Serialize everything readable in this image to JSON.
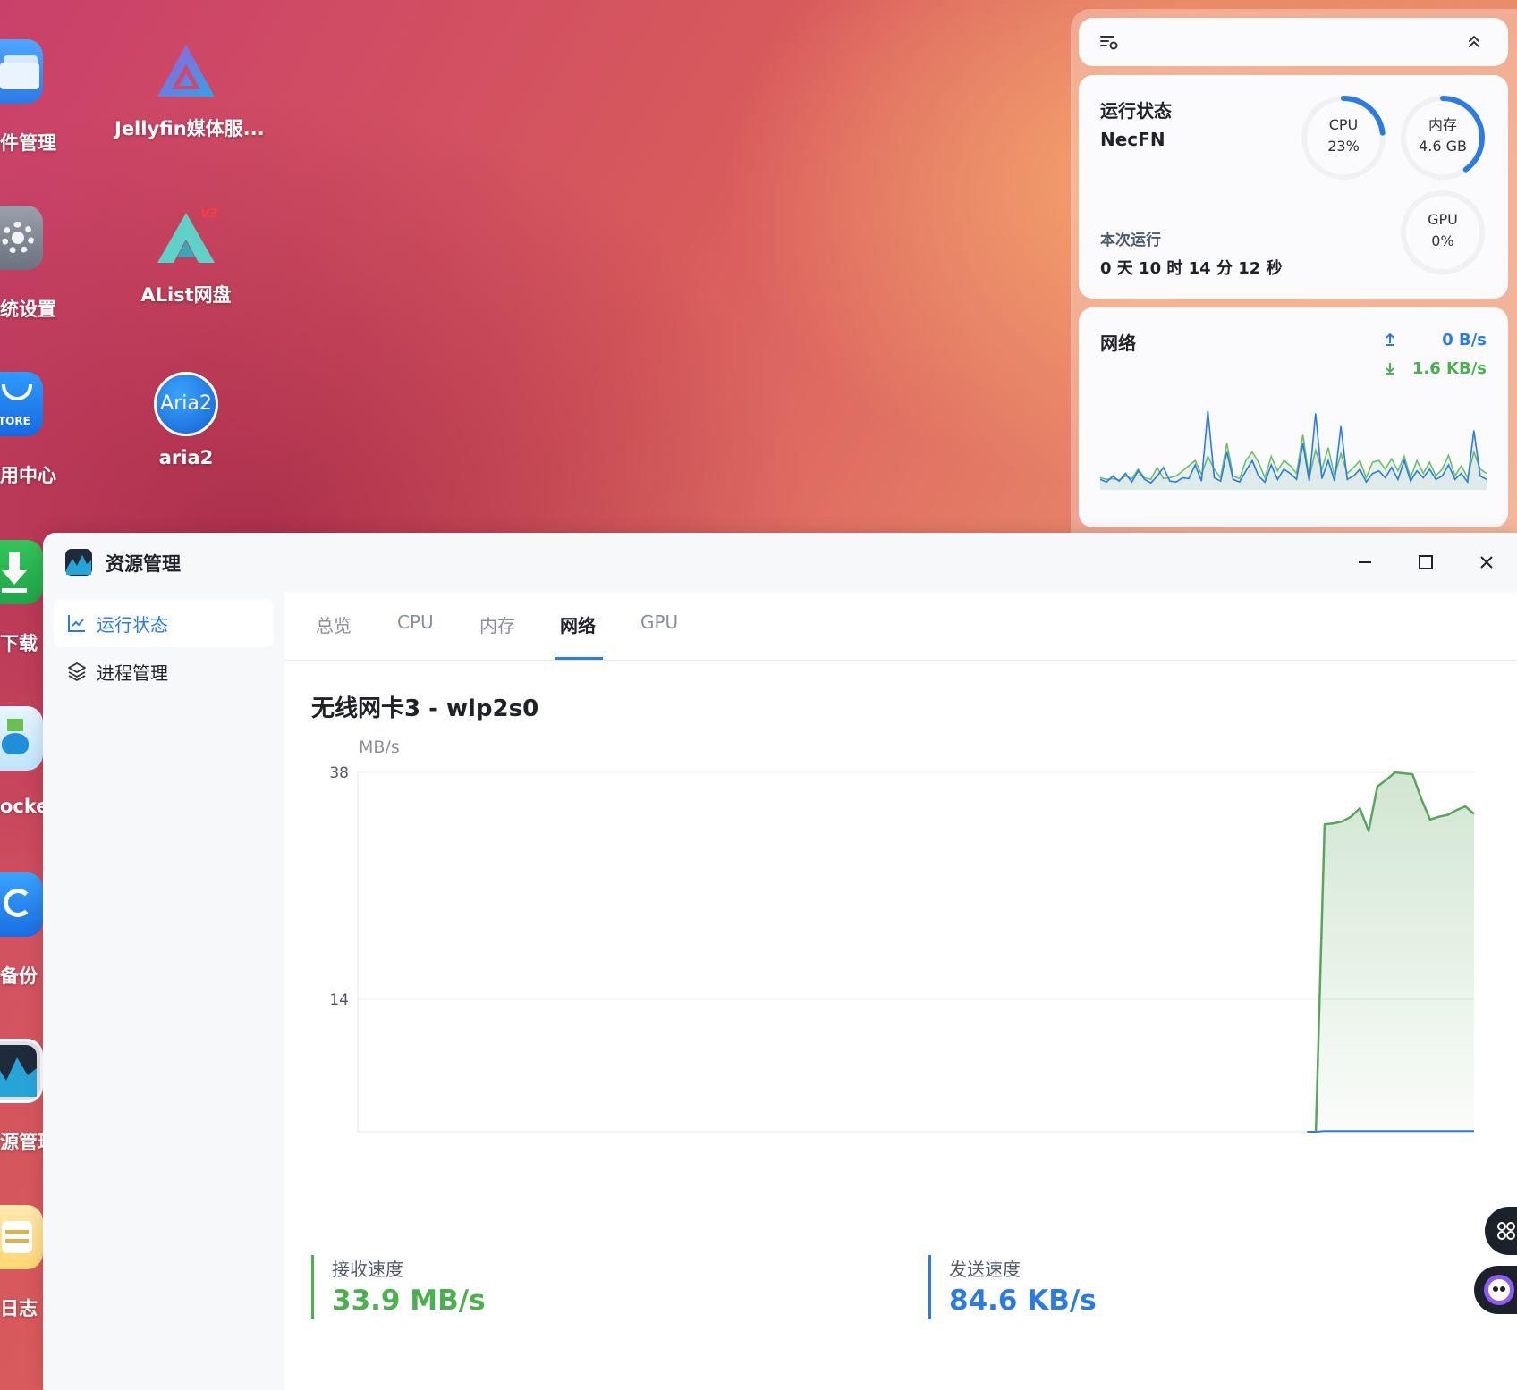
{
  "desktop": {
    "apps_col1": [
      {
        "label": "件管理"
      },
      {
        "label": "统设置"
      },
      {
        "label": "用中心",
        "badge": "TORE"
      }
    ],
    "apps_col2": [
      {
        "label": "Jellyfin媒体服..."
      },
      {
        "label": "AList网盘",
        "badge": "V3"
      },
      {
        "label": "aria2",
        "icon_text": "Aria2"
      }
    ],
    "dock": [
      {
        "label": "下载"
      },
      {
        "label": "ocker"
      },
      {
        "label": "备份"
      },
      {
        "label": "源管理"
      },
      {
        "label": "日志"
      }
    ]
  },
  "widgets": {
    "status": {
      "title": "运行状态",
      "host": "NecFN",
      "uptime_label": "本次运行",
      "uptime_value": "0 天 10 时 14 分 12 秒",
      "cpu": {
        "label": "CPU",
        "value": "23%",
        "fraction": 0.23
      },
      "memory": {
        "label": "内存",
        "value": "4.6 GB",
        "fraction": 0.4
      },
      "gpu": {
        "label": "GPU",
        "value": "0%",
        "fraction": 0
      }
    },
    "network": {
      "title": "网络",
      "upload": "0 B/s",
      "download": "1.6 KB/s"
    }
  },
  "window": {
    "title": "资源管理",
    "sidebar": [
      {
        "label": "运行状态",
        "active": true
      },
      {
        "label": "进程管理",
        "active": false
      }
    ],
    "tabs": [
      {
        "label": "总览"
      },
      {
        "label": "CPU"
      },
      {
        "label": "内存"
      },
      {
        "label": "网络",
        "active": true
      },
      {
        "label": "GPU"
      }
    ],
    "adapter_title": "无线网卡3 - wlp2s0",
    "receive": {
      "label": "接收速度",
      "value": "33.9 MB/s",
      "color": "#4caf50"
    },
    "send": {
      "label": "发送速度",
      "value": "84.6 KB/s",
      "color": "#2b7be5"
    }
  },
  "chart_data": {
    "type": "area",
    "ylabel": "MB/s",
    "yticks": [
      14,
      38
    ],
    "ylim": [
      0,
      38
    ],
    "grid": true,
    "series": [
      {
        "color": "#5aa55c",
        "values": [
          0,
          0,
          0,
          0,
          0,
          0,
          0,
          0,
          0,
          0,
          0,
          0,
          0,
          0,
          0,
          0,
          0,
          0,
          0,
          0,
          0,
          0,
          0,
          0,
          0,
          0,
          0,
          0,
          0,
          0,
          0,
          0,
          0,
          0,
          0,
          0,
          0,
          0,
          0,
          0,
          0,
          0,
          0,
          0,
          0,
          0,
          0,
          0,
          0,
          0,
          0,
          0,
          0,
          0,
          0,
          0,
          0,
          0,
          0,
          0,
          0,
          0,
          0,
          0,
          0,
          0,
          0,
          0,
          0,
          0,
          0,
          0,
          0,
          0,
          0,
          0,
          0,
          0,
          0,
          0,
          0,
          0,
          0,
          0,
          0,
          0,
          0,
          0,
          0,
          0,
          0,
          0,
          0,
          0,
          0,
          0,
          0,
          0,
          0,
          0,
          0,
          0,
          0,
          0,
          0,
          0,
          0,
          0,
          0,
          0,
          32.5,
          32.6,
          32.8,
          33.3,
          34.2,
          31.8,
          36.5,
          37.2,
          38.0,
          37.9,
          37.8,
          35.2,
          33.0,
          33.3,
          33.5,
          34.0,
          34.4,
          33.6
        ]
      },
      {
        "color": "#2b7be5",
        "values": [
          0,
          0,
          0,
          0,
          0,
          0,
          0,
          0,
          0,
          0,
          0,
          0,
          0,
          0,
          0,
          0,
          0,
          0,
          0,
          0,
          0,
          0,
          0,
          0,
          0,
          0,
          0,
          0,
          0,
          0,
          0,
          0,
          0,
          0,
          0,
          0,
          0,
          0,
          0,
          0,
          0,
          0,
          0,
          0,
          0,
          0,
          0,
          0,
          0,
          0,
          0,
          0,
          0,
          0,
          0,
          0,
          0,
          0,
          0,
          0,
          0,
          0,
          0,
          0,
          0,
          0,
          0,
          0,
          0,
          0,
          0,
          0,
          0,
          0,
          0,
          0,
          0,
          0,
          0,
          0,
          0,
          0,
          0,
          0,
          0,
          0,
          0,
          0,
          0,
          0,
          0,
          0,
          0,
          0,
          0,
          0,
          0,
          0,
          0,
          0,
          0,
          0,
          0,
          0,
          0,
          0,
          0,
          0,
          0,
          0,
          0.08,
          0.08,
          0.08,
          0.08,
          0.08,
          0.08,
          0.08,
          0.08,
          0.08,
          0.08,
          0.08,
          0.08,
          0.08,
          0.08,
          0.08,
          0.08,
          0.08,
          0.08
        ]
      }
    ]
  },
  "mini_chart": {
    "upload": [
      8,
      5,
      12,
      6,
      15,
      5,
      18,
      8,
      4,
      12,
      22,
      6,
      5,
      10,
      9,
      25,
      6,
      88,
      10,
      6,
      40,
      8,
      5,
      18,
      30,
      12,
      5,
      25,
      8,
      20,
      15,
      8,
      50,
      6,
      85,
      9,
      30,
      6,
      70,
      8,
      12,
      20,
      5,
      15,
      18,
      10,
      22,
      8,
      30,
      6,
      18,
      10,
      20,
      8,
      12,
      25,
      8,
      15,
      5,
      65,
      12,
      8
    ],
    "download": [
      10,
      8,
      9,
      7,
      12,
      9,
      20,
      10,
      8,
      22,
      9,
      10,
      12,
      18,
      24,
      30,
      14,
      35,
      20,
      10,
      50,
      12,
      9,
      30,
      40,
      28,
      10,
      35,
      18,
      30,
      24,
      15,
      60,
      10,
      42,
      20,
      45,
      12,
      38,
      15,
      22,
      30,
      10,
      28,
      30,
      20,
      32,
      18,
      35,
      10,
      30,
      15,
      28,
      12,
      20,
      36,
      12,
      24,
      10,
      40,
      20,
      15
    ]
  }
}
